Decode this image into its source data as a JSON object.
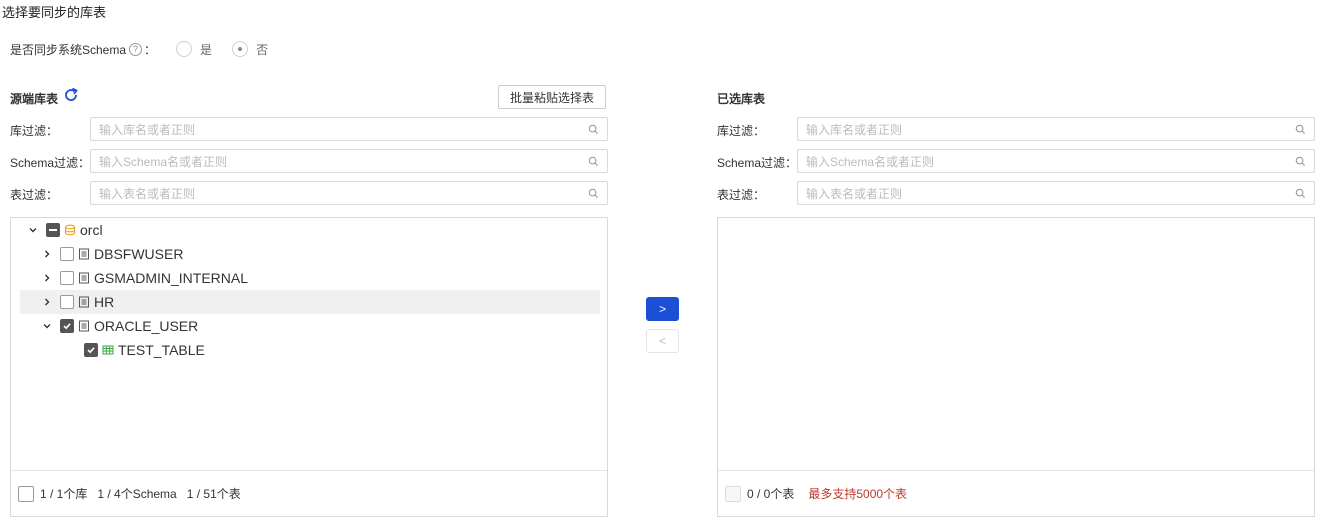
{
  "page_title": "选择要同步的库表",
  "sync_schema": {
    "label": "是否同步系统Schema",
    "help": "?",
    "colon": "：",
    "options": [
      "是",
      "否"
    ],
    "selected": "否"
  },
  "source": {
    "title": "源端库表",
    "batch_button": "批量粘贴选择表",
    "filters": [
      {
        "label": "库过滤：",
        "placeholder": "输入库名或者正则"
      },
      {
        "label": "Schema过滤：",
        "placeholder": "输入Schema名或者正则"
      },
      {
        "label": "表过滤：",
        "placeholder": "输入表名或者正则"
      }
    ],
    "tree": {
      "root": {
        "label": "orcl",
        "state": "indeterminate",
        "expanded": true
      },
      "schemas": [
        {
          "label": "DBSFWUSER",
          "state": "unchecked",
          "expanded": false
        },
        {
          "label": "GSMADMIN_INTERNAL",
          "state": "unchecked",
          "expanded": false
        },
        {
          "label": "HR",
          "state": "unchecked",
          "expanded": false,
          "hover": true
        },
        {
          "label": "ORACLE_USER",
          "state": "checked",
          "expanded": true
        }
      ],
      "tables": [
        {
          "label": "TEST_TABLE",
          "state": "checked"
        }
      ]
    },
    "footer": {
      "db_count": "1 / 1个库",
      "schema_count": "1 / 4个Schema",
      "table_count": "1 / 51个表"
    }
  },
  "transfer": {
    "add_label": ">",
    "remove_label": "<"
  },
  "target": {
    "title": "已选库表",
    "filters": [
      {
        "label": "库过滤：",
        "placeholder": "输入库名或者正则"
      },
      {
        "label": "Schema过滤：",
        "placeholder": "输入Schema名或者正则"
      },
      {
        "label": "表过滤：",
        "placeholder": "输入表名或者正则"
      }
    ],
    "footer": {
      "table_count": "0 / 0个表",
      "limit_text": "最多支持5000个表"
    }
  },
  "colors": {
    "primary": "#1b4fd6",
    "warning": "#c0392b",
    "db_icon": "#f0a020",
    "table_icon": "#3aa64a"
  }
}
